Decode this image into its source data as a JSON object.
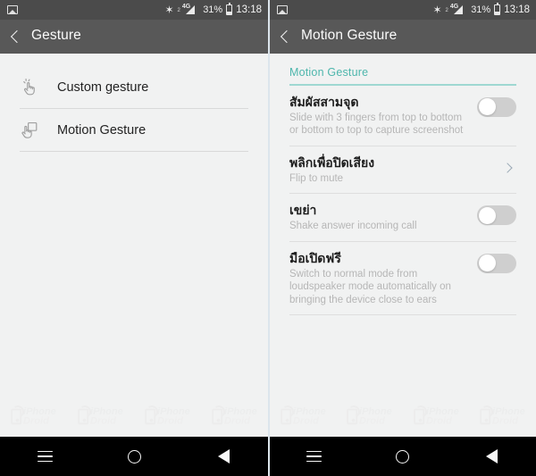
{
  "status_bar": {
    "notification_icon": "image-icon",
    "bluetooth_icon": "bluetooth-icon",
    "sim_slot": "2",
    "network_type": "4G",
    "signal_icon": "signal-bars-icon",
    "battery_percent": "31%",
    "battery_icon": "battery-icon",
    "time": "13:18"
  },
  "colors": {
    "status_bar_bg": "#4b4b4b",
    "app_bar_bg": "#585858",
    "content_bg": "#f1f2f2",
    "accent_teal": "#4db6ac",
    "nav_bar_bg": "#000000",
    "divider": "#d9d9d9",
    "toggle_track_off": "#cfcfcf",
    "description_text": "#b6b6b6"
  },
  "left_screen": {
    "title": "Gesture",
    "back_icon": "back-chevron-icon",
    "items": [
      {
        "label": "Custom gesture",
        "icon": "custom-gesture-icon"
      },
      {
        "label": "Motion Gesture",
        "icon": "motion-gesture-icon"
      }
    ]
  },
  "right_screen": {
    "title": "Motion Gesture",
    "back_icon": "back-chevron-icon",
    "section_header": "Motion Gesture",
    "settings": [
      {
        "title": "สัมผัสสามจุด",
        "description": "Slide with 3 fingers from top to bottom or bottom to top to capture screenshot",
        "control": "toggle",
        "toggle_state": "off"
      },
      {
        "title": "พลิกเพื่อปิดเสียง",
        "description": "Flip to mute",
        "control": "chevron",
        "chevron_icon": "chevron-right-icon"
      },
      {
        "title": "เขย่า",
        "description": "Shake answer incoming call",
        "control": "toggle",
        "toggle_state": "off"
      },
      {
        "title": "มือเปิดฟรี",
        "description": "Switch to normal mode from loudspeaker mode automatically on bringing the device close to ears",
        "control": "toggle",
        "toggle_state": "off"
      }
    ]
  },
  "watermark": {
    "line1": "iPhone",
    "line2": "Droid",
    "icon": "phone-signal-icon",
    "repeat": 4
  },
  "nav_bar": {
    "recents_label": "recents-menu-icon",
    "home_label": "home-circle-icon",
    "back_label": "back-triangle-icon"
  }
}
